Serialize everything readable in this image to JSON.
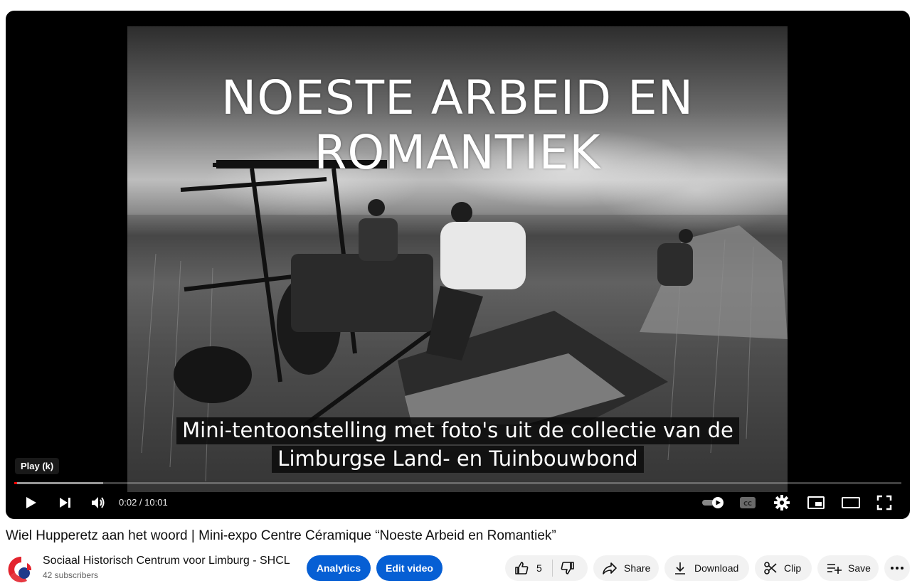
{
  "player": {
    "overlay_title": "NOESTE ARBEID EN ROMANTIEK",
    "captions": [
      "Mini-tentoonstelling met foto's uit de collectie van de",
      "Limburgse Land- en Tuinbouwbond"
    ],
    "tooltip": "Play (k)",
    "time_display": "0:02 / 10:01",
    "progress_played": 0.003,
    "progress_loaded": 0.1,
    "accent_color": "#ff0000"
  },
  "video": {
    "title": "Wiel Hupperetz aan het woord | Mini-expo Centre Céramique “Noeste Arbeid en Romantiek”"
  },
  "channel": {
    "name": "Sociaal Historisch Centrum voor Limburg - SHCL",
    "subscribers": "42 subscribers"
  },
  "actions": {
    "analytics": "Analytics",
    "edit_video": "Edit video",
    "like_count": "5",
    "share": "Share",
    "download": "Download",
    "clip": "Clip",
    "save": "Save"
  },
  "colors": {
    "primary_button": "#065fd4",
    "secondary_button": "#f2f2f2"
  }
}
